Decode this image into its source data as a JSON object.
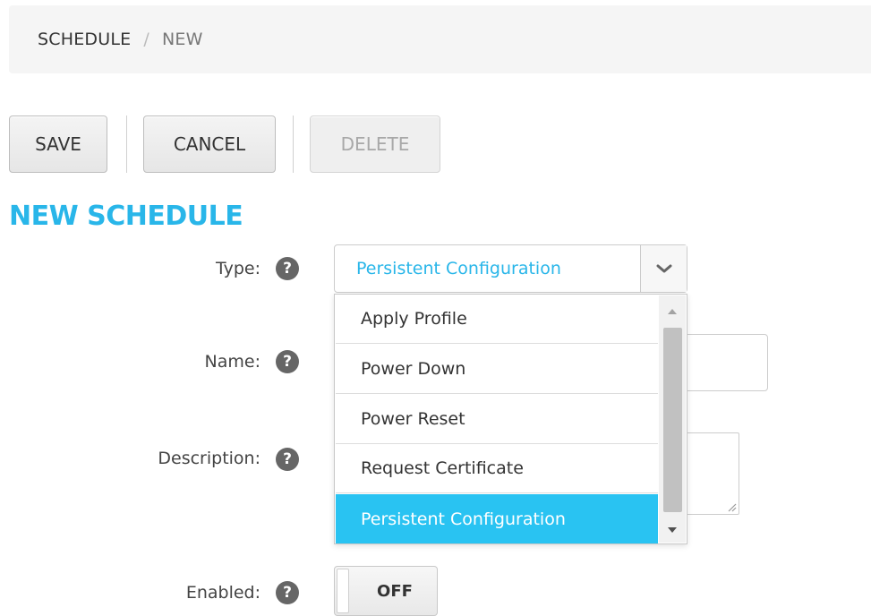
{
  "breadcrumb": {
    "root": "SCHEDULE",
    "separator": "/",
    "current": "NEW"
  },
  "toolbar": {
    "save_label": "SAVE",
    "cancel_label": "CANCEL",
    "delete_label": "DELETE"
  },
  "page_title": "NEW SCHEDULE",
  "form": {
    "type_label": "Type:",
    "type_value": "Persistent Configuration",
    "name_label": "Name:",
    "name_value": "",
    "description_label": "Description:",
    "description_value": "",
    "enabled_label": "Enabled:",
    "enabled_state": "OFF",
    "help_glyph": "?"
  },
  "dropdown": {
    "options": [
      "Apply Profile",
      "Power Down",
      "Power Reset",
      "Request Certificate",
      "Persistent Configuration"
    ],
    "selected_index": 4
  },
  "colors": {
    "accent": "#29b6e9",
    "selected_option": "#29c3f2"
  },
  "icons": {
    "help": "help-icon",
    "select_arrow": "chevron-down-icon",
    "scroll_up": "scroll-up-arrow-icon",
    "scroll_down": "scroll-down-arrow-icon",
    "resize": "resize-grip-icon"
  }
}
